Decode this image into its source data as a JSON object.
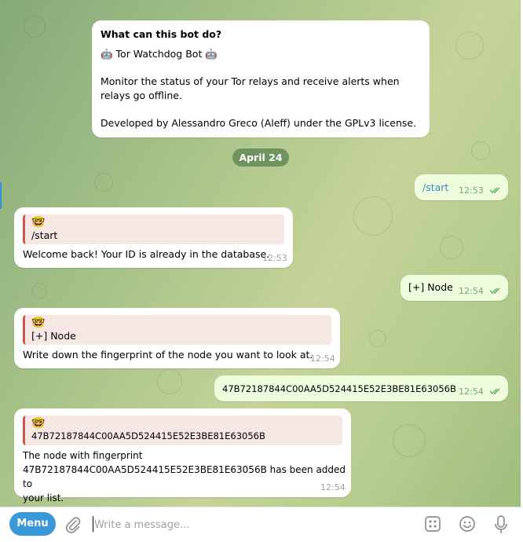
{
  "intro": {
    "heading": "What can this bot do?",
    "bot_name_line": "🤖 Tor Watchdog Bot 🤖",
    "description": "Monitor the status of your Tor relays and receive alerts when relays go offline.",
    "credits": "Developed by Alessandro Greco (Aleff) under the GPLv3 license."
  },
  "date_separator": "April 24",
  "messages": [
    {
      "direction": "out",
      "text": "/start",
      "time": "12:53"
    },
    {
      "direction": "in",
      "quote_icon": "🤓",
      "quote_text": "/start",
      "text": "Welcome back! Your ID is already in the database.",
      "time": "12:53"
    },
    {
      "direction": "out",
      "text": "[+] Node",
      "time": "12:54"
    },
    {
      "direction": "in",
      "quote_icon": "🤓",
      "quote_text": "[+] Node",
      "text": "Write down the fingerprint of the node you want to look at.",
      "time": "12:54"
    },
    {
      "direction": "out",
      "text": "47B72187844C00AA5D524415E52E3BE81E63056B",
      "time": "12:54"
    },
    {
      "direction": "in",
      "quote_icon": "🤓",
      "quote_text": "47B72187844C00AA5D524415E52E3BE81E63056B",
      "text": "The node with fingerprint\n47B72187844C00AA5D524415E52E3BE81E63056B has been added to\nyour list.",
      "time": "12:54"
    }
  ],
  "composer": {
    "menu_label": "Menu",
    "placeholder": "Write a message..."
  },
  "colors": {
    "accent": "#3a97d8",
    "outgoing_bubble": "#effdde",
    "quote_bar": "#d0574f",
    "quote_bg": "#f6e6e4",
    "read_ticks": "#5fb55a"
  },
  "icons": [
    "attach-icon",
    "bot-commands-icon",
    "emoji-icon",
    "microphone-icon",
    "double-check-icon"
  ]
}
